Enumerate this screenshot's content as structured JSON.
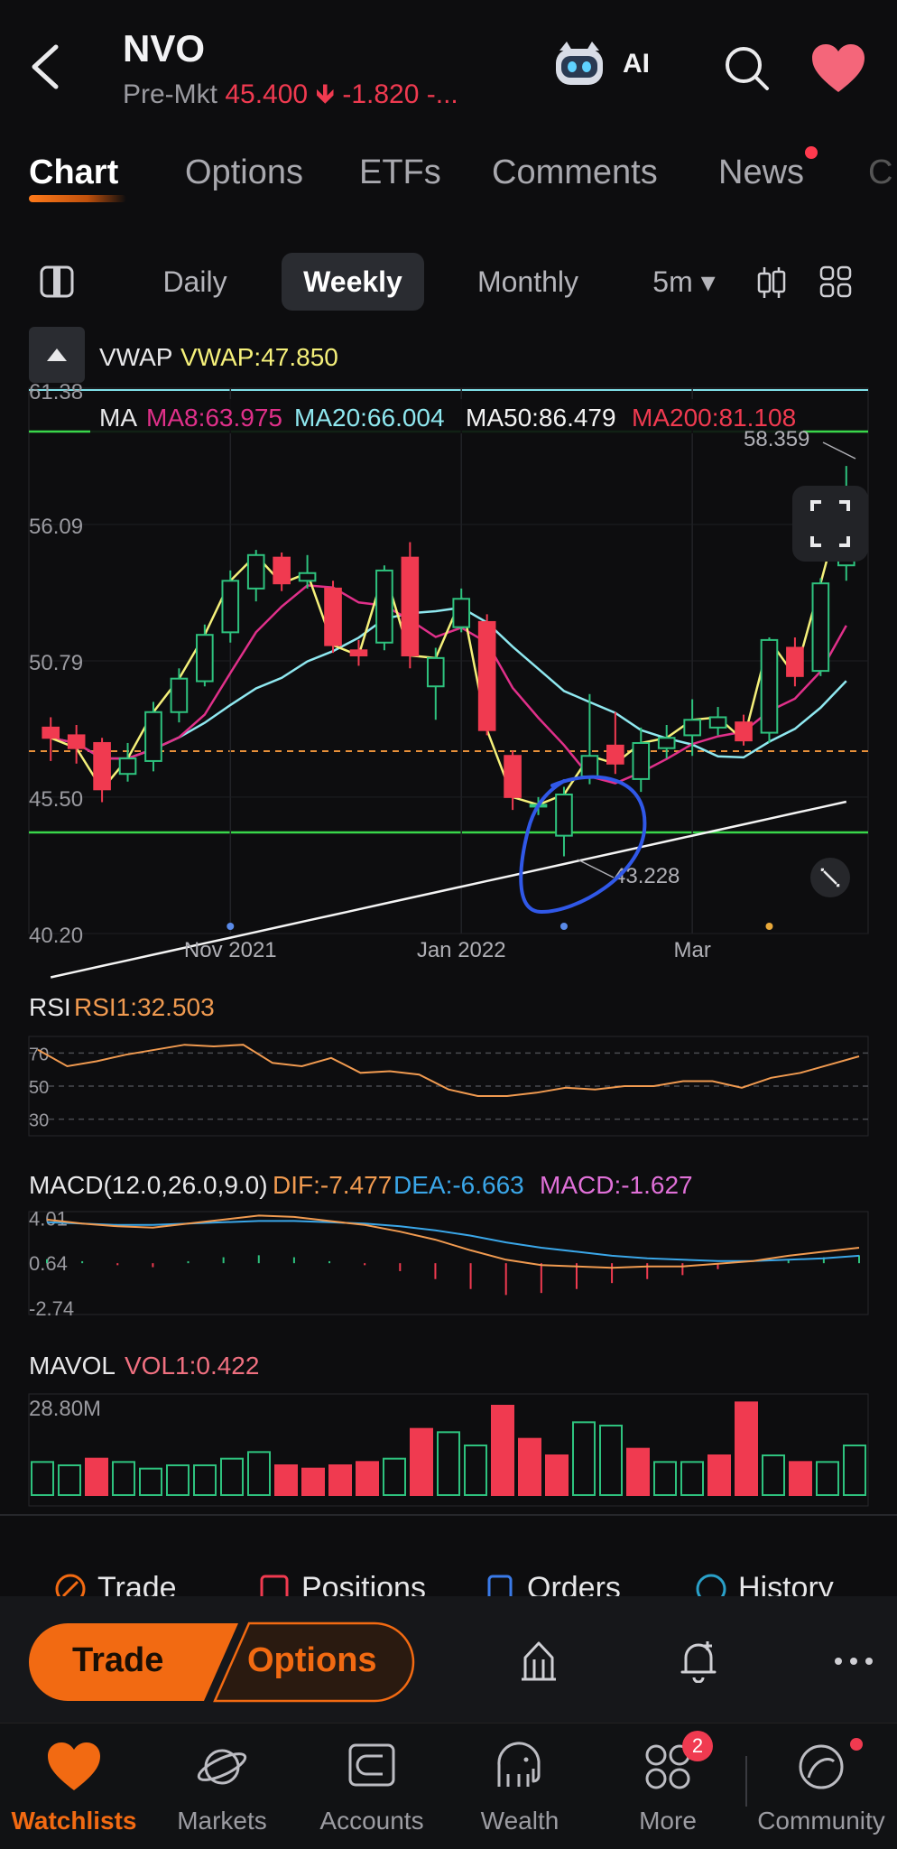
{
  "header": {
    "ticker": "NVO",
    "session": "Pre-Mkt",
    "price": "45.400",
    "change": "-1.820",
    "change_pct": "-...",
    "ai_label": "AI"
  },
  "tabs": [
    {
      "label": "Chart",
      "active": true
    },
    {
      "label": "Options"
    },
    {
      "label": "ETFs"
    },
    {
      "label": "Comments"
    },
    {
      "label": "News"
    },
    {
      "label": "C"
    }
  ],
  "periods": [
    {
      "label": "Daily"
    },
    {
      "label": "Weekly",
      "active": true
    },
    {
      "label": "Monthly"
    },
    {
      "label": "5m ▾"
    }
  ],
  "overlay": {
    "vwap_name": "VWAP",
    "vwap_value": "VWAP:47.850",
    "ma_name": "MA",
    "ma8": "MA8:63.975",
    "ma20": "MA20:66.004",
    "ma50": "MA50:86.479",
    "ma200": "MA200:81.108",
    "high_label": "58.359",
    "low_label": "43.228",
    "top_tick": "61.38"
  },
  "chart_data": {
    "type": "candlestick",
    "y_ticks": [
      "56.09",
      "50.79",
      "45.50",
      "40.20"
    ],
    "ylim": [
      40.2,
      61.38
    ],
    "x_ticks": [
      "Nov 2021",
      "Jan 2022",
      "Mar"
    ],
    "candles": [
      {
        "o": 48.2,
        "c": 47.8,
        "h": 48.6,
        "l": 46.9
      },
      {
        "o": 47.9,
        "c": 47.4,
        "h": 48.3,
        "l": 46.8
      },
      {
        "o": 47.6,
        "c": 45.8,
        "h": 47.8,
        "l": 45.3
      },
      {
        "o": 46.4,
        "c": 47.0,
        "h": 47.6,
        "l": 46.1
      },
      {
        "o": 46.9,
        "c": 48.8,
        "h": 49.2,
        "l": 46.5
      },
      {
        "o": 48.8,
        "c": 50.1,
        "h": 50.5,
        "l": 48.4
      },
      {
        "o": 50.0,
        "c": 51.8,
        "h": 52.2,
        "l": 49.8
      },
      {
        "o": 51.9,
        "c": 53.9,
        "h": 54.3,
        "l": 51.5
      },
      {
        "o": 53.6,
        "c": 54.9,
        "h": 55.1,
        "l": 53.1
      },
      {
        "o": 54.8,
        "c": 53.8,
        "h": 55.0,
        "l": 53.5
      },
      {
        "o": 53.9,
        "c": 54.2,
        "h": 54.9,
        "l": 53.6
      },
      {
        "o": 53.6,
        "c": 51.4,
        "h": 53.9,
        "l": 51.1
      },
      {
        "o": 51.2,
        "c": 51.0,
        "h": 51.6,
        "l": 50.6
      },
      {
        "o": 51.5,
        "c": 54.3,
        "h": 54.5,
        "l": 51.2
      },
      {
        "o": 54.8,
        "c": 51.0,
        "h": 55.4,
        "l": 50.5
      },
      {
        "o": 49.8,
        "c": 50.9,
        "h": 51.3,
        "l": 48.5
      },
      {
        "o": 52.1,
        "c": 53.2,
        "h": 53.6,
        "l": 51.9
      },
      {
        "o": 52.3,
        "c": 48.1,
        "h": 52.6,
        "l": 47.9
      },
      {
        "o": 47.1,
        "c": 45.5,
        "h": 47.3,
        "l": 45.0
      },
      {
        "o": 45.2,
        "c": 45.2,
        "h": 45.5,
        "l": 44.8
      },
      {
        "o": 44.0,
        "c": 45.6,
        "h": 45.9,
        "l": 43.2
      },
      {
        "o": 46.3,
        "c": 47.1,
        "h": 49.5,
        "l": 46.0
      },
      {
        "o": 47.5,
        "c": 46.8,
        "h": 48.8,
        "l": 46.4
      },
      {
        "o": 46.2,
        "c": 47.6,
        "h": 48.2,
        "l": 45.7
      },
      {
        "o": 47.4,
        "c": 47.8,
        "h": 48.3,
        "l": 47.0
      },
      {
        "o": 47.9,
        "c": 48.5,
        "h": 49.3,
        "l": 47.1
      },
      {
        "o": 48.2,
        "c": 48.6,
        "h": 49.0,
        "l": 47.9
      },
      {
        "o": 48.4,
        "c": 47.7,
        "h": 48.7,
        "l": 47.5
      },
      {
        "o": 48.0,
        "c": 51.6,
        "h": 51.7,
        "l": 47.6
      },
      {
        "o": 51.3,
        "c": 50.2,
        "h": 51.7,
        "l": 49.8
      },
      {
        "o": 50.4,
        "c": 53.8,
        "h": 54.0,
        "l": 50.2
      },
      {
        "o": 54.5,
        "c": 57.5,
        "h": 58.36,
        "l": 53.9
      }
    ],
    "rsi": {
      "label": "RSI",
      "value_label": "RSI1:32.503",
      "ticks": [
        "70",
        "50",
        "30"
      ],
      "values": [
        72,
        62,
        65,
        69,
        72,
        75,
        74,
        75,
        64,
        62,
        67,
        58,
        59,
        57,
        48,
        44,
        44,
        46,
        49,
        48,
        50,
        50,
        53,
        53,
        49,
        55,
        58,
        63,
        68
      ]
    },
    "macd": {
      "label": "MACD(12.0,26.0,9.0)",
      "dif": "DIF:-7.477",
      "dea": "DEA:-6.663",
      "macd": "MACD:-1.627",
      "ticks": [
        "4.01",
        "0.64",
        "-2.74"
      ],
      "dif_values": [
        3.9,
        3.6,
        3.4,
        3.3,
        3.6,
        3.9,
        4.2,
        4.1,
        3.8,
        3.5,
        3.0,
        2.4,
        1.6,
        0.9,
        0.5,
        0.4,
        0.3,
        0.4,
        0.4,
        0.6,
        0.8,
        1.2,
        1.5,
        1.8
      ],
      "dea_values": [
        3.7,
        3.6,
        3.5,
        3.5,
        3.6,
        3.7,
        3.8,
        3.8,
        3.7,
        3.6,
        3.4,
        3.1,
        2.7,
        2.2,
        1.8,
        1.5,
        1.2,
        1.0,
        0.9,
        0.8,
        0.8,
        0.9,
        1.0,
        1.2
      ],
      "hist": [
        0.2,
        0.1,
        -0.1,
        -0.2,
        0.1,
        0.3,
        0.4,
        0.3,
        0.1,
        -0.1,
        -0.4,
        -0.8,
        -1.3,
        -1.6,
        -1.5,
        -1.3,
        -1.0,
        -0.8,
        -0.6,
        -0.3,
        0.0,
        0.2,
        0.3,
        0.4
      ]
    },
    "mavol": {
      "label": "MAVOL",
      "value_label": "VOL1:0.422",
      "max_label": "28.80M",
      "bars": [
        10,
        9,
        11,
        10,
        8,
        9,
        9,
        11,
        13,
        9,
        8,
        9,
        10,
        11,
        20,
        19,
        15,
        27,
        17,
        12,
        22,
        21,
        14,
        10,
        10,
        12,
        28,
        12,
        10,
        10,
        15
      ],
      "up": [
        true,
        true,
        false,
        true,
        true,
        true,
        true,
        true,
        true,
        false,
        false,
        false,
        false,
        true,
        false,
        true,
        true,
        false,
        false,
        false,
        true,
        true,
        false,
        true,
        true,
        false,
        false,
        true,
        false,
        true,
        true
      ]
    }
  },
  "quick_actions": [
    "Trade",
    "Positions",
    "Orders",
    "History"
  ],
  "action_bar": {
    "trade": "Trade",
    "options": "Options"
  },
  "nav": [
    {
      "label": "Watchlists",
      "active": true
    },
    {
      "label": "Markets"
    },
    {
      "label": "Accounts"
    },
    {
      "label": "Wealth"
    },
    {
      "label": "More",
      "badge": "2"
    },
    {
      "label": "Community"
    }
  ],
  "colors": {
    "up": "#2ec27e",
    "down": "#f03a50",
    "accent": "#f26a12",
    "vwap": "#f5f07a",
    "ma20": "#e0308a",
    "ma50": "#8fe8f0",
    "ma200": "#f4f4f4"
  }
}
